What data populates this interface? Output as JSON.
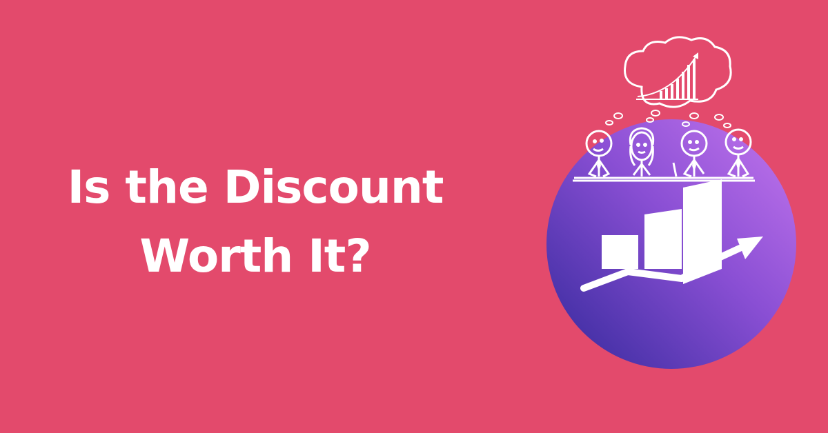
{
  "headline": {
    "line1": "Is the Discount",
    "line2": "Worth It?"
  },
  "colors": {
    "background": "#e34a6c",
    "text": "#ffffff",
    "circle_top": "#b26be6",
    "circle_bottom": "#3a2a9c"
  },
  "illustration": {
    "icons": [
      "thought-cloud-icon",
      "rising-chart-icon",
      "stick-figure-icon",
      "bar-chart-arrow-icon"
    ]
  }
}
